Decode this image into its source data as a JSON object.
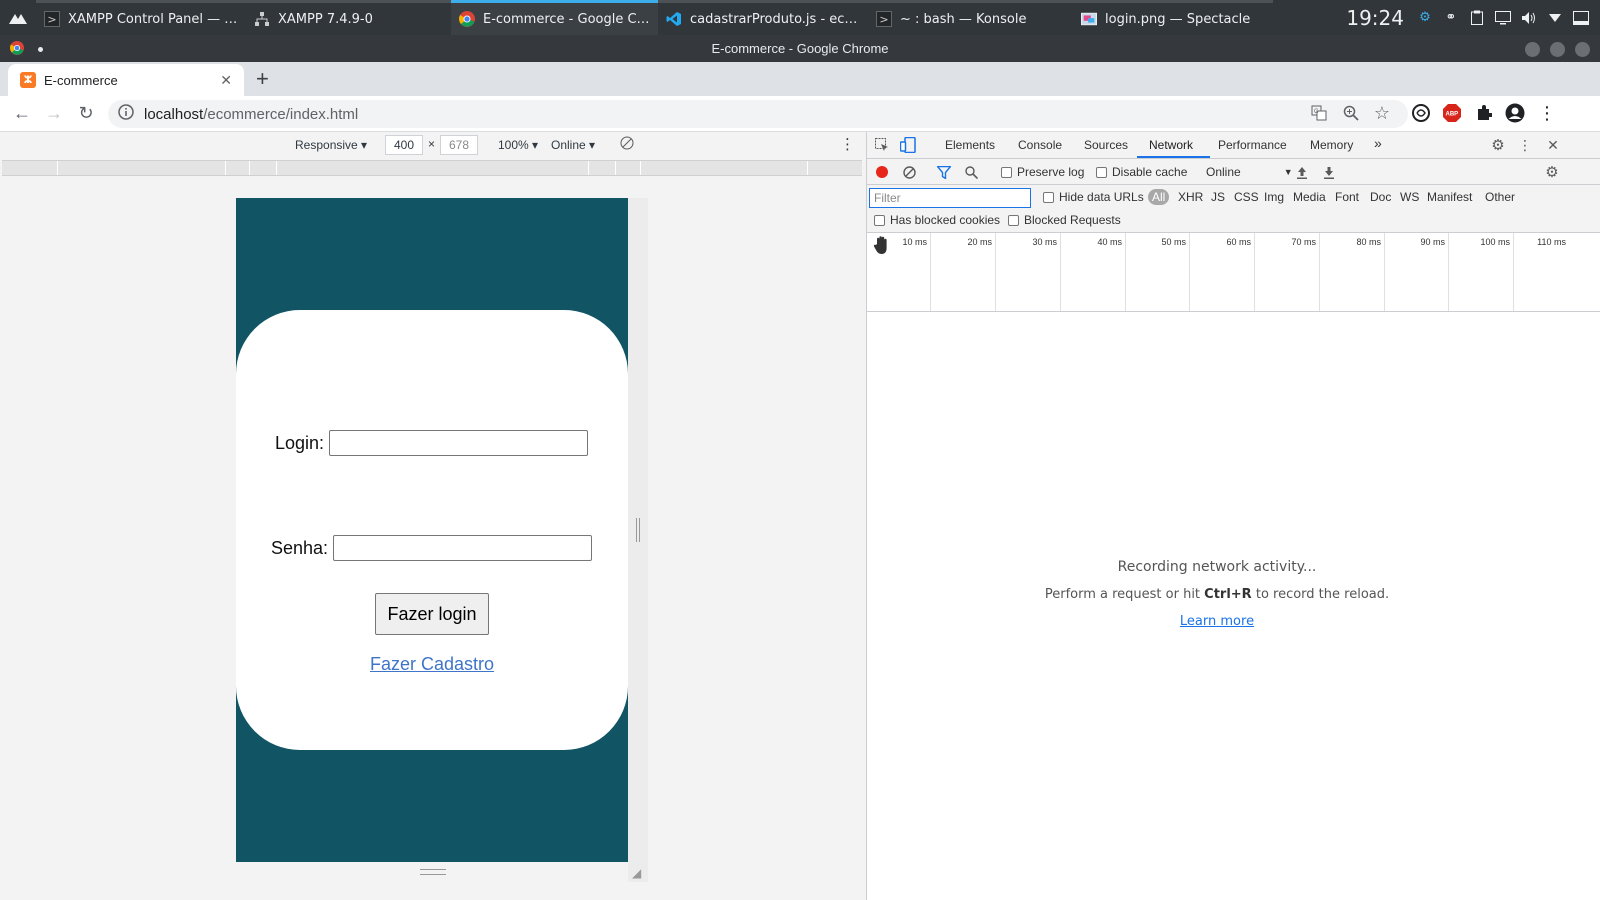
{
  "taskbar": {
    "tasks": [
      {
        "label": "XAMPP Control Panel — Ko...",
        "icon": "terminal-icon"
      },
      {
        "label": "XAMPP 7.4.9-0",
        "icon": "network-icon"
      },
      {
        "label": "E-commerce - Google Chro...",
        "icon": "chrome-icon"
      },
      {
        "label": "cadastrarProduto.js - ecom...",
        "icon": "vscode-icon"
      },
      {
        "label": "~ : bash — Konsole",
        "icon": "terminal-icon"
      },
      {
        "label": "login.png — Spectacle",
        "icon": "spectacle-icon"
      }
    ],
    "clock": "19:24"
  },
  "window": {
    "title": "E-commerce - Google Chrome"
  },
  "browser": {
    "tab_title": "E-commerce",
    "url_host": "localhost",
    "url_path": "/ecommerce/index.html"
  },
  "device_toolbar": {
    "device": "Responsive",
    "width": "400",
    "height": "678",
    "zoom": "100%",
    "throttle": "Online"
  },
  "page": {
    "login_label": "Login:",
    "password_label": "Senha:",
    "login_button": "Fazer login",
    "signup_link": "Fazer Cadastro",
    "colors": {
      "background": "#115565",
      "card": "#ffffff",
      "link": "#3f74c9"
    }
  },
  "devtools": {
    "tabs": [
      "Elements",
      "Console",
      "Sources",
      "Network",
      "Performance",
      "Memory"
    ],
    "active_tab": "Network",
    "preserve_log": "Preserve log",
    "disable_cache": "Disable cache",
    "throttle": "Online",
    "filter_placeholder": "Filter",
    "hide_data_urls": "Hide data URLs",
    "types": [
      "All",
      "XHR",
      "JS",
      "CSS",
      "Img",
      "Media",
      "Font",
      "Doc",
      "WS",
      "Manifest",
      "Other"
    ],
    "has_blocked_cookies": "Has blocked cookies",
    "blocked_requests": "Blocked Requests",
    "timeline_ticks": [
      "10 ms",
      "20 ms",
      "30 ms",
      "40 ms",
      "50 ms",
      "60 ms",
      "70 ms",
      "80 ms",
      "90 ms",
      "100 ms",
      "110 ms"
    ],
    "empty_title": "Recording network activity...",
    "empty_hint_pre": "Perform a request or hit",
    "empty_hint_key": "Ctrl+R",
    "empty_hint_post": "to record the reload.",
    "learn_more": "Learn more"
  }
}
